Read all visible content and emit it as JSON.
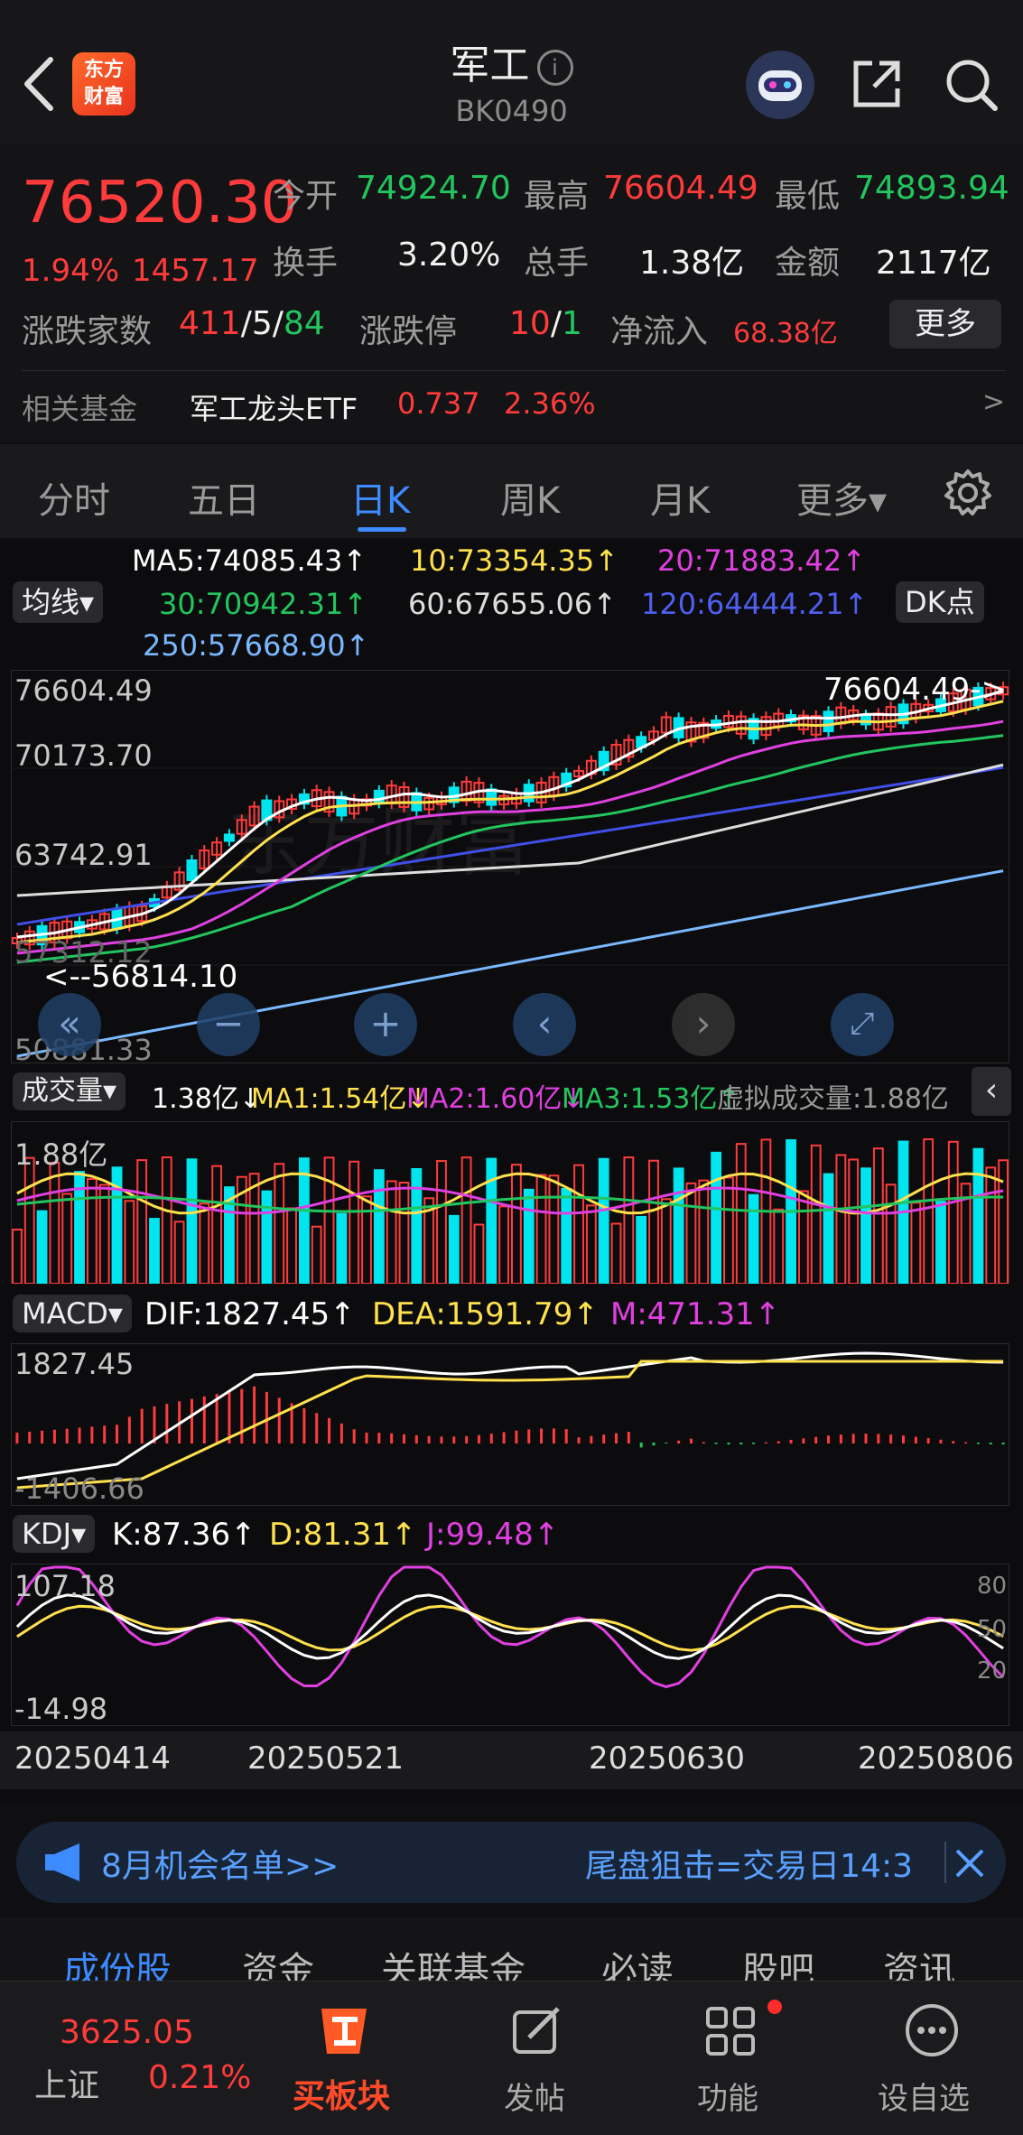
{
  "header": {
    "title": "军工",
    "code": "BK0490",
    "logo_text_1": "东方",
    "logo_text_2": "财富"
  },
  "quote": {
    "price": "76520.30",
    "change_pct": "1.94%",
    "change_abs": "1457.17",
    "open_label": "今开",
    "open": "74924.70",
    "high_label": "最高",
    "high": "76604.49",
    "low_label": "最低",
    "low": "74893.94",
    "turnover_label": "换手",
    "turnover": "3.20%",
    "volume_label": "总手",
    "volume": "1.38亿",
    "amount_label": "金额",
    "amount": "2117亿",
    "breadth_label": "涨跌家数",
    "breadth_up": "411",
    "breadth_flat": "5",
    "breadth_down": "84",
    "slash": "/",
    "limit_label": "涨跌停",
    "limit_up": "10",
    "limit_down": "1",
    "netflow_label": "净流入",
    "netflow": "68.38亿",
    "more_button": "更多",
    "fund_label": "相关基金",
    "fund_name": "军工龙头ETF",
    "fund_price": "0.737",
    "fund_pct": "2.36%",
    "fund_arrow": ">"
  },
  "tabs": [
    "分时",
    "五日",
    "日K",
    "周K",
    "月K",
    "更多▾"
  ],
  "active_tab": 2,
  "kline": {
    "indicator_select": "均线▾",
    "dk_button": "DK点",
    "ma5": "MA5:74085.43↑",
    "ma10": "10:73354.35↑",
    "ma20": "20:71883.42↑",
    "ma30": "30:70942.31↑",
    "ma60": "60:67655.06↑",
    "ma120": "120:64444.21↑",
    "ma250": "250:57668.90↑",
    "y_max": "76604.49",
    "y_2": "70173.70",
    "y_3": "63742.91",
    "y_4": "57312.12",
    "y_min": "50881.33",
    "high_marker": "76604.49->",
    "low_marker": "<--56814.10",
    "colors": {
      "ma5": "#ffffff",
      "ma10": "#ffe14d",
      "ma20": "#e040e0",
      "ma30": "#22c55e",
      "ma60": "#dddddd",
      "ma120": "#3f4fe8",
      "ma250": "#7ab8ff",
      "up": "#ff3b3b",
      "down": "#00e5ee"
    }
  },
  "volume": {
    "select": "成交量▾",
    "vol": "1.38亿↓",
    "ma1": "MA1:1.54亿↓",
    "ma2": "MA2:1.60亿↓",
    "ma3": "MA3:1.53亿↑",
    "virtual": "虚拟成交量:1.88亿",
    "y_max": "1.88亿"
  },
  "macd": {
    "select": "MACD▾",
    "dif": "DIF:1827.45↑",
    "dea": "DEA:1591.79↑",
    "m": "M:471.31↑",
    "y_max": "1827.45",
    "y_min": "-1406.66"
  },
  "kdj": {
    "select": "KDJ▾",
    "k": "K:87.36↑",
    "d": "D:81.31↑",
    "j": "J:99.48↑",
    "y_max": "107.18",
    "y_min": "-14.98",
    "r80": "80",
    "r50": "50",
    "r20": "20"
  },
  "dates": [
    "20250414",
    "20250521",
    "20250630",
    "20250806"
  ],
  "banner": {
    "left": "8月机会名单>>",
    "right": "尾盘狙击=交易日14:3"
  },
  "subtabs": [
    "成份股",
    "资金",
    "关联基金",
    "必读",
    "股吧",
    "资讯"
  ],
  "nav": {
    "index_value": "3625.05",
    "index_name": "上证",
    "index_pct": "0.21%",
    "buy": "买板块",
    "post": "发帖",
    "func": "功能",
    "watch": "设自选"
  }
}
